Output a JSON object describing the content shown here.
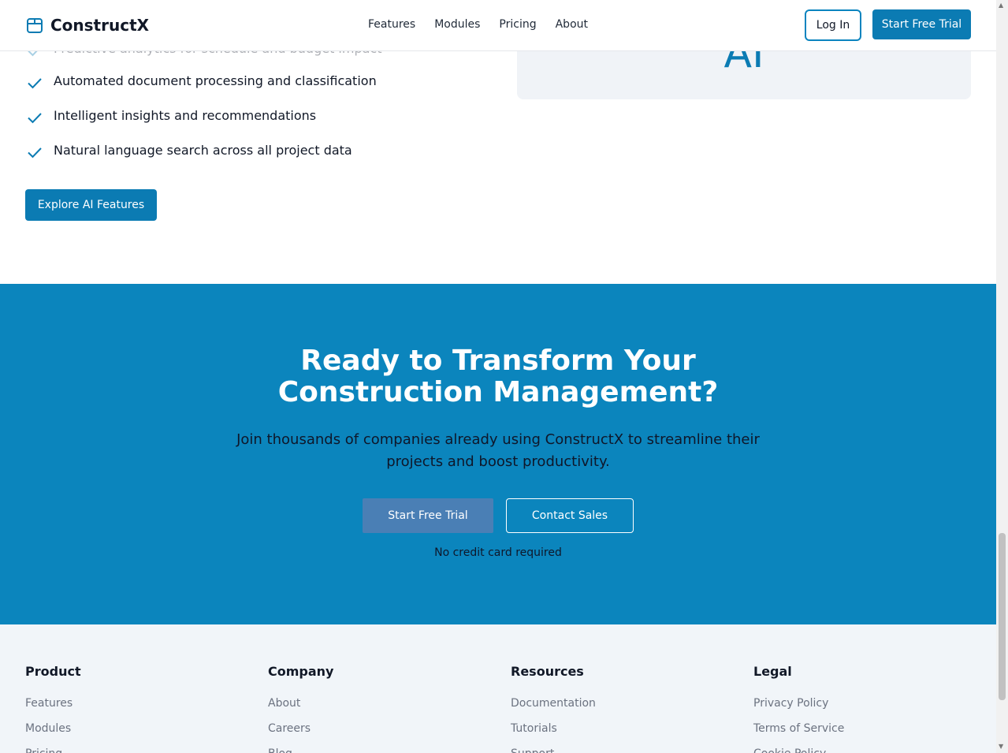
{
  "header": {
    "brand": "ConstructX",
    "nav": [
      "Features",
      "Modules",
      "Pricing",
      "About"
    ],
    "login_label": "Log In",
    "trial_label": "Start Free Trial"
  },
  "ai_section": {
    "features": [
      "Predictive analytics for schedule and budget impact",
      "Automated document processing and classification",
      "Intelligent insights and recommendations",
      "Natural language search across all project data"
    ],
    "explore_label": "Explore AI Features",
    "card_text": "AI"
  },
  "cta": {
    "title_line1": "Ready to Transform Your",
    "title_line2": "Construction Management?",
    "subtitle_line1": "Join thousands of companies already using ConstructX to streamline their",
    "subtitle_line2": "projects and boost productivity.",
    "primary_label": "Start Free Trial",
    "secondary_label": "Contact Sales",
    "note": "No credit card required"
  },
  "footer": {
    "columns": [
      {
        "title": "Product",
        "links": [
          "Features",
          "Modules",
          "Pricing"
        ]
      },
      {
        "title": "Company",
        "links": [
          "About",
          "Careers",
          "Blog"
        ]
      },
      {
        "title": "Resources",
        "links": [
          "Documentation",
          "Tutorials",
          "Support"
        ]
      },
      {
        "title": "Legal",
        "links": [
          "Privacy Policy",
          "Terms of Service",
          "Cookie Policy"
        ]
      }
    ]
  },
  "colors": {
    "accent": "#0b7bb3",
    "cta_background": "#0b85bd",
    "footer_background": "#f1f5f9"
  },
  "icons": [
    "box-icon",
    "check-icon"
  ]
}
